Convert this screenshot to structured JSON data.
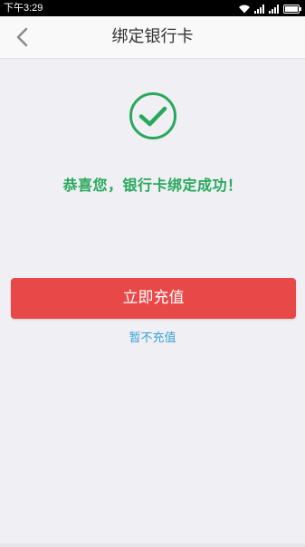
{
  "status_bar": {
    "time": "下午3:29",
    "icons": [
      "wifi-icon",
      "signal-icon",
      "signal-icon",
      "battery-icon"
    ]
  },
  "nav": {
    "title": "绑定银行卡",
    "back_icon": "chevron-left-icon"
  },
  "result": {
    "icon": "check-circle-icon",
    "message": "恭喜您，银行卡绑定成功！"
  },
  "actions": {
    "primary_label": "立即充值",
    "secondary_label": "暂不充值"
  },
  "colors": {
    "accent_green": "#28a85b",
    "button_red": "#e84848",
    "link_blue": "#3a9fd8",
    "background": "#efeff4"
  }
}
